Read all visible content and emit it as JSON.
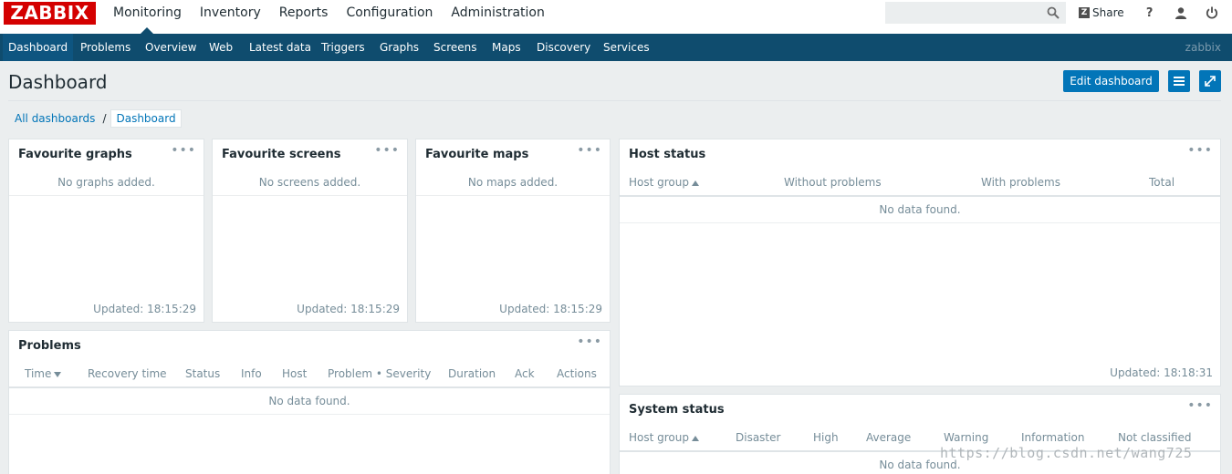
{
  "logo": "ZABBIX",
  "main_menu": [
    "Monitoring",
    "Inventory",
    "Reports",
    "Configuration",
    "Administration"
  ],
  "search": {
    "placeholder": ""
  },
  "top_icons": {
    "share_label": "Share",
    "help_label": "?"
  },
  "sub_menu": [
    "Dashboard",
    "Problems",
    "Overview",
    "Web",
    "Latest data",
    "Triggers",
    "Graphs",
    "Screens",
    "Maps",
    "Discovery",
    "Services"
  ],
  "user": "zabbix",
  "page_title": "Dashboard",
  "edit_dashboard": "Edit dashboard",
  "breadcrumb": {
    "all": "All dashboards",
    "sep": "/",
    "current": "Dashboard"
  },
  "widgets": {
    "fav_graphs": {
      "title": "Favourite graphs",
      "empty": "No graphs added.",
      "updated": "Updated: 18:15:29"
    },
    "fav_screens": {
      "title": "Favourite screens",
      "empty": "No screens added.",
      "updated": "Updated: 18:15:29"
    },
    "fav_maps": {
      "title": "Favourite maps",
      "empty": "No maps added.",
      "updated": "Updated: 18:15:29"
    },
    "host_status": {
      "title": "Host status",
      "columns": [
        "Host group",
        "Without problems",
        "With problems",
        "Total"
      ],
      "empty": "No data found.",
      "updated": "Updated: 18:18:31"
    },
    "problems": {
      "title": "Problems",
      "columns": [
        "Time",
        "Recovery time",
        "Status",
        "Info",
        "Host",
        "Problem • Severity",
        "Duration",
        "Ack",
        "Actions"
      ],
      "empty": "No data found."
    },
    "system_status": {
      "title": "System status",
      "columns": [
        "Host group",
        "Disaster",
        "High",
        "Average",
        "Warning",
        "Information",
        "Not classified"
      ],
      "empty": "No data found."
    },
    "menu_glyph": "•••"
  },
  "watermark": "https://blog.csdn.net/wang725",
  "colors": {
    "brand": "#d40000",
    "nav": "#0f4c6e",
    "accent": "#0275b8"
  }
}
